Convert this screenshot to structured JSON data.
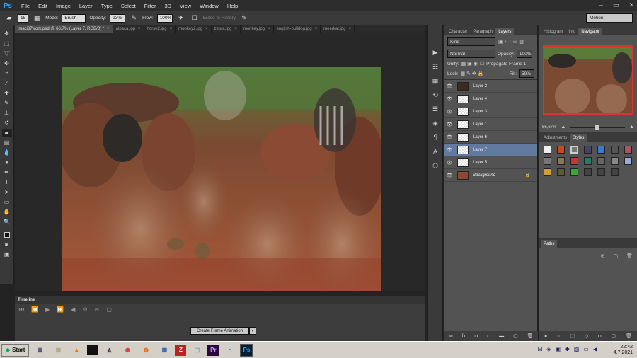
{
  "app": {
    "logo": "Ps"
  },
  "menu": [
    "File",
    "Edit",
    "Image",
    "Layer",
    "Type",
    "Select",
    "Filter",
    "3D",
    "View",
    "Window",
    "Help"
  ],
  "options": {
    "brush_size": "15",
    "mode_label": "Mode:",
    "mode_value": "Brush",
    "opacity_label": "Opacity:",
    "opacity_value": "93%",
    "flow_label": "Flow:",
    "flow_value": "100%",
    "erase_history": "Erase to History",
    "workspace": "Motion"
  },
  "tabs": [
    {
      "label": "lmaci87work.psd @ 66,7% (Layer 7, RGB/8) *",
      "active": true
    },
    {
      "label": "alpaca.jpg"
    },
    {
      "label": "horse2.jpg"
    },
    {
      "label": "monkey2.jpg"
    },
    {
      "label": "zebra.jpg"
    },
    {
      "label": "monkey.jpg"
    },
    {
      "label": "english-bulldog.jpg"
    },
    {
      "label": "meerkat.jpg"
    }
  ],
  "timeline": {
    "title": "Timeline",
    "create_button": "Create Frame Animation"
  },
  "layers_panel": {
    "tabs": [
      "Character",
      "Paragraph",
      "Layers"
    ],
    "kind": "Kind",
    "blend": "Normal",
    "opacity_label": "Opacity:",
    "opacity_value": "100%",
    "unify": "Unify:",
    "propagate": "Propagate Frame 1",
    "lock": "Lock:",
    "fill_label": "Fill:",
    "fill_value": "59%",
    "layers": [
      {
        "name": "Layer 2"
      },
      {
        "name": "Layer 4"
      },
      {
        "name": "Layer 3"
      },
      {
        "name": "Layer 1"
      },
      {
        "name": "Layer 6"
      },
      {
        "name": "Layer 7",
        "selected": true
      },
      {
        "name": "Layer 5"
      },
      {
        "name": "Background",
        "locked": true
      }
    ]
  },
  "right_panel": {
    "tabs": [
      "Histogram",
      "Info",
      "Navigator"
    ],
    "zoom": "66,67%",
    "adj_tabs": [
      "Adjustments",
      "Styles"
    ],
    "paths_tab": "Paths"
  },
  "taskbar": {
    "start": "Start",
    "time": "22:42",
    "date": "4.7.2021"
  },
  "colors": {
    "accent": "#31a8ff",
    "selected_layer": "#627aa0",
    "panel_bg": "#535353"
  }
}
